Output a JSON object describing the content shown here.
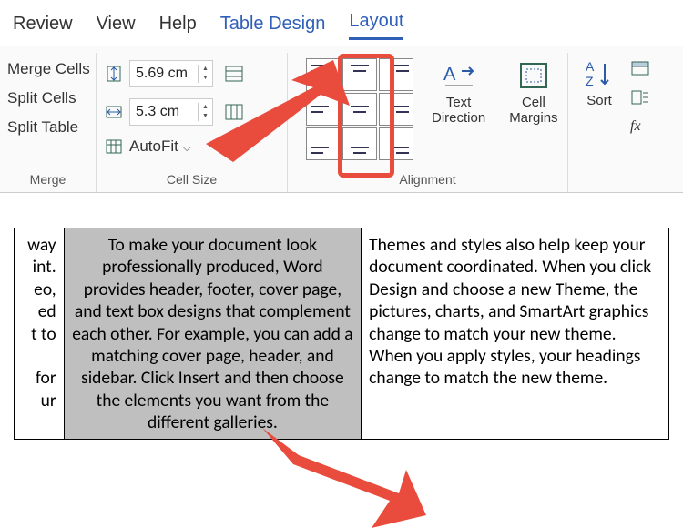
{
  "tabs": {
    "review": "Review",
    "view": "View",
    "help": "Help",
    "table_design": "Table Design",
    "layout": "Layout"
  },
  "merge": {
    "merge_cells": "Merge Cells",
    "split_cells": "Split Cells",
    "split_table": "Split Table",
    "label": "Merge"
  },
  "cell_size": {
    "height": "5.69 cm",
    "width": "5.3 cm",
    "autofit": "AutoFit",
    "label": "Cell Size"
  },
  "alignment": {
    "text_direction": "Text\nDirection",
    "cell_margins": "Cell\nMargins",
    "label": "Alignment"
  },
  "data_group": {
    "sort": "Sort"
  },
  "doc": {
    "c1_lines": [
      "way",
      "int.",
      "eo,",
      "ed",
      "t to",
      "for",
      "ur"
    ],
    "c2": "To make your document look professionally produced, Word provides header, footer, cover page, and text box designs that complement each other. For example, you can add a matching cover page, header, and sidebar. Click Insert and then choose the elements you want from the different galleries.",
    "c3": "Themes and styles also help keep your document coordinated. When you click Design and choose a new Theme, the pictures, charts, and SmartArt graphics change to match your new theme. When you apply styles, your headings change to match the new theme."
  }
}
